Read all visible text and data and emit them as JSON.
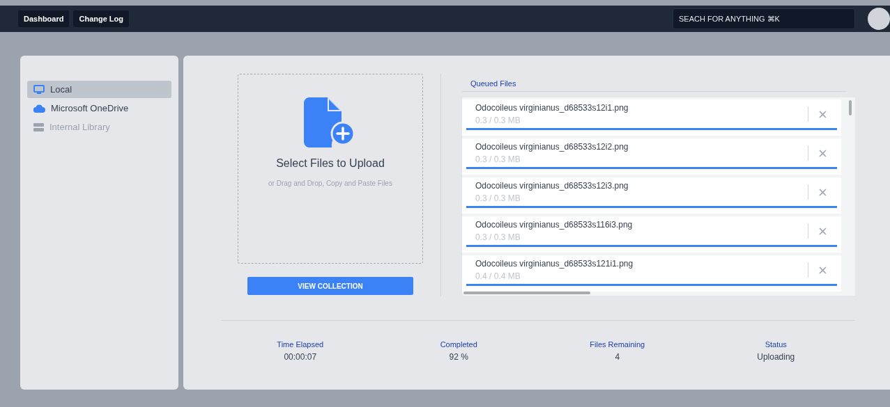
{
  "topbar": {
    "nav": [
      {
        "label": "Dashboard"
      },
      {
        "label": "Change Log"
      }
    ],
    "search": {
      "placeholder": "SEACH FOR ANYTHING ⌘K"
    }
  },
  "sidebar": {
    "items": [
      {
        "label": "Local",
        "kind": "computer",
        "selected": true,
        "disabled": false
      },
      {
        "label": "Microsoft OneDrive",
        "kind": "cloud",
        "selected": false,
        "disabled": false
      },
      {
        "label": "Internal Library",
        "kind": "server",
        "selected": false,
        "disabled": true
      }
    ]
  },
  "upload": {
    "title": "Select Files to Upload",
    "hint": "or Drag and Drop, Copy and Paste Files",
    "button": "VIEW COLLECTION"
  },
  "queue": {
    "title": "Queued Files",
    "files": [
      {
        "name": "Odocoileus virginianus_d68533s12i1.png",
        "size": "0.3 / 0.3 MB",
        "level": 1
      },
      {
        "name": "Odocoileus virginianus_d68533s12i2.png",
        "size": "0.3 / 0.3 MB",
        "level": 1
      },
      {
        "name": "Odocoileus virginianus_d68533s12i3.png",
        "size": "0.3 / 0.3 MB",
        "level": 1
      },
      {
        "name": "Odocoileus virginianus_d68533s116i3.png",
        "size": "0.3 / 0.3 MB",
        "level": 1
      },
      {
        "name": "Odocoileus virginianus_d68533s121i1.png",
        "size": "0.4 / 0.4 MB",
        "level": 1
      }
    ]
  },
  "stats": [
    {
      "label": "Time Elapsed",
      "value": "00:00:07"
    },
    {
      "label": "Completed",
      "value": "92 %"
    },
    {
      "label": "Files Remaining",
      "value": "4"
    },
    {
      "label": "Status",
      "value": "Uploading"
    }
  ]
}
